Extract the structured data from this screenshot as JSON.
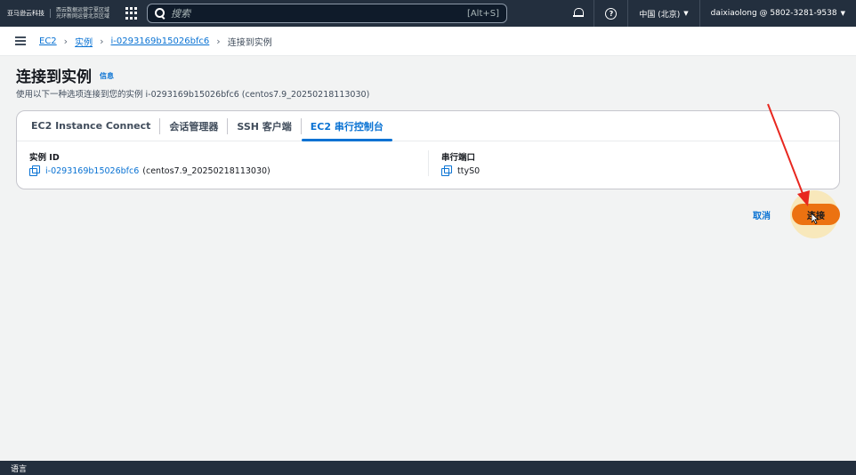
{
  "topnav": {
    "logo_main": "亚马逊云科技",
    "logo_sub_line1": "西云数据运营宁夏区域",
    "logo_sub_line2": "光环新网运营北京区域",
    "search_placeholder": "搜索",
    "search_shortcut": "[Alt+S]",
    "region": "中国 (北京)",
    "account": "daixiaolong @ 5802-3281-9538"
  },
  "breadcrumb": {
    "items": [
      "EC2",
      "实例",
      "i-0293169b15026bfc6"
    ],
    "current": "连接到实例"
  },
  "header": {
    "title": "连接到实例",
    "info": "信息",
    "description": "使用以下一种选项连接到您的实例 i-0293169b15026bfc6 (centos7.9_20250218113030)"
  },
  "tabs": [
    "EC2 Instance Connect",
    "会话管理器",
    "SSH 客户端",
    "EC2 串行控制台"
  ],
  "active_tab": "EC2 串行控制台",
  "instance_field": {
    "label": "实例 ID",
    "id": "i-0293169b15026bfc6",
    "name": "(centos7.9_20250218113030)"
  },
  "port_field": {
    "label": "串行端口",
    "value": "ttyS0"
  },
  "actions": {
    "cancel": "取消",
    "connect": "连接"
  },
  "footer": {
    "language": "语言"
  },
  "colors": {
    "nav_bg": "#232f3e",
    "link": "#0972d3",
    "primary_button": "#ec7211",
    "annotation_arrow": "#e8271f"
  }
}
